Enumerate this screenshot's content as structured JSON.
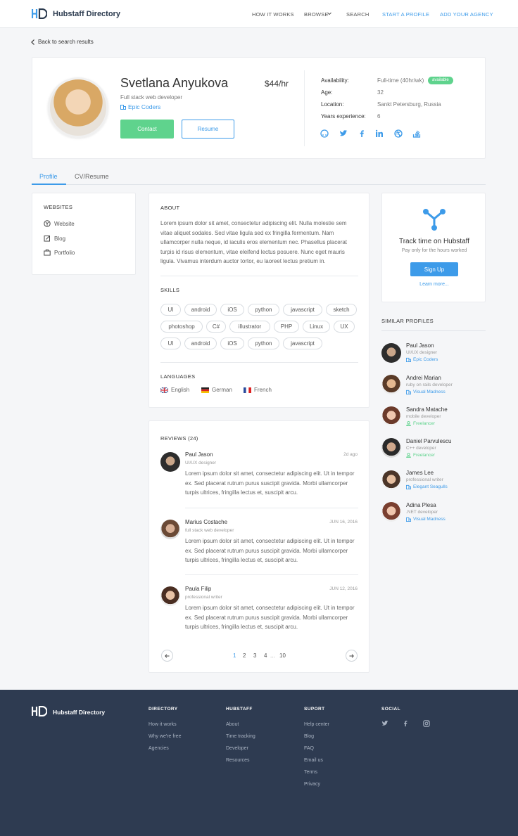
{
  "header": {
    "brand": "Hubstaff Directory",
    "nav": [
      {
        "label": "HOW IT WORKS"
      },
      {
        "label": "BROWSE"
      },
      {
        "label": "SEARCH"
      },
      {
        "label": "START A PROFILE"
      },
      {
        "label": "ADD YOUR AGENCY"
      }
    ]
  },
  "back_link": "Back to search results",
  "profile": {
    "name": "Svetlana Anyukova",
    "rate": "$44/hr",
    "role": "Full stack web developer",
    "agency": "Epic Coders",
    "contact_label": "Contact",
    "resume_label": "Resume",
    "details": [
      {
        "label": "Availability:",
        "value": "Full-time (40hr/wk)"
      },
      {
        "label": "Age:",
        "value": "32"
      },
      {
        "label": "Location:",
        "value": "Sankt Petersburg, Russia"
      },
      {
        "label": "Years experience:",
        "value": "6"
      }
    ],
    "availability_badge": "available",
    "social_icons": [
      "github-icon",
      "twitter-icon",
      "facebook-icon",
      "linkedin-icon",
      "dribbble-icon",
      "stackoverflow-icon"
    ]
  },
  "tabs": [
    {
      "label": "Profile"
    },
    {
      "label": "CV/Resume"
    }
  ],
  "websites": {
    "title": "WEBSITES",
    "items": [
      {
        "label": "Website"
      },
      {
        "label": "Blog"
      },
      {
        "label": "Portfolio"
      }
    ]
  },
  "about": {
    "title": "ABOUT",
    "text": "Lorem ipsum dolor sit amet, consectetur adipiscing elit. Nulla molestie sem vitae aliquet sodales. Sed vitae ligula sed ex fringilla fermentum. Nam ullamcorper nulla neque, id iaculis eros elementum nec. Phasellus placerat turpis id risus elementum, vitae eleifend lectus posuere. Nunc eget mauris ligula. Vivamus interdum auctor tortor, eu laoreet lectus pretium in."
  },
  "skills": {
    "title": "SKILLS",
    "items": [
      "UI",
      "android",
      "iOS",
      "python",
      "javascript",
      "sketch",
      "photoshop",
      "C#",
      "illustrator",
      "PHP",
      "Linux",
      "UX",
      "UI",
      "android",
      "iOS",
      "python",
      "javascript"
    ]
  },
  "languages": {
    "title": "LANGUAGES",
    "items": [
      {
        "label": "English"
      },
      {
        "label": "German"
      },
      {
        "label": "French"
      }
    ]
  },
  "reviews": {
    "title": "REVIEWS (24)",
    "items": [
      {
        "name": "Paul Jason",
        "role": "UI/UX designer",
        "date": "2d ago",
        "text": "Lorem ipsum dolor sit amet, consectetur adipiscing elit. Ut in tempor ex. Sed placerat rutrum purus suscipit gravida. Morbi ullamcorper turpis ultrices, fringilla lectus et, suscipit arcu."
      },
      {
        "name": "Marius Costache",
        "role": "full stack web developer",
        "date": "JUN 16, 2016",
        "text": "Lorem ipsum dolor sit amet, consectetur adipiscing elit. Ut in tempor ex. Sed placerat rutrum purus suscipit gravida. Morbi ullamcorper turpis ultrices, fringilla lectus et, suscipit arcu."
      },
      {
        "name": "Paula Filip",
        "role": "professional writer",
        "date": "JUN 12, 2016",
        "text": "Lorem ipsum dolor sit amet, consectetur adipiscing elit. Ut in tempor ex. Sed placerat rutrum purus suscipit gravida. Morbi ullamcorper turpis ultrices, fringilla lectus et, suscipit arcu."
      }
    ],
    "pagination": {
      "pages": [
        "1",
        "2",
        "3",
        "4"
      ],
      "ellipsis": "...",
      "last": "10",
      "current": "1"
    }
  },
  "promo": {
    "title": "Track time on Hubstaff",
    "subtitle": "Pay only for the hours worked",
    "button": "Sign Up",
    "link": "Learn more..."
  },
  "similar": {
    "title": "SIMILAR PROFILES",
    "items": [
      {
        "name": "Paul Jason",
        "role": "UI/UX designer",
        "agency": "Epic Coders",
        "type": "agency"
      },
      {
        "name": "Andrei Marian",
        "role": "ruby on rails developer",
        "agency": "Visual Madness",
        "type": "agency"
      },
      {
        "name": "Sandra Matache",
        "role": "mobile developer",
        "agency": "Freelancer",
        "type": "freelancer"
      },
      {
        "name": "Daniel Parvulescu",
        "role": "C++ developer",
        "agency": "Freelancer",
        "type": "freelancer"
      },
      {
        "name": "James Lee",
        "role": "professional writer",
        "agency": "Elegant Seagulls",
        "type": "agency"
      },
      {
        "name": "Adina Plesa",
        "role": ".NET developer",
        "agency": "Visual Madness",
        "type": "agency"
      }
    ]
  },
  "footer": {
    "brand": "Hubstaff Directory",
    "columns": [
      {
        "title": "DIRECTORY",
        "links": [
          "How it works",
          "Why we're free",
          "Agencies"
        ]
      },
      {
        "title": "HUBSTAFF",
        "links": [
          "About",
          "Time tracking",
          "Developer",
          "Resources"
        ]
      },
      {
        "title": "SUPORT",
        "links": [
          "Help center",
          "Blog",
          "FAQ",
          "Email us",
          "Terms",
          "Privacy"
        ]
      },
      {
        "title": "SOCIAL",
        "links": []
      }
    ],
    "social_icons": [
      "twitter-icon",
      "facebook-icon",
      "instagram-icon"
    ]
  },
  "colors": {
    "accent": "#3d9be9",
    "green": "#5fd38d",
    "footer": "#2e3b51"
  }
}
